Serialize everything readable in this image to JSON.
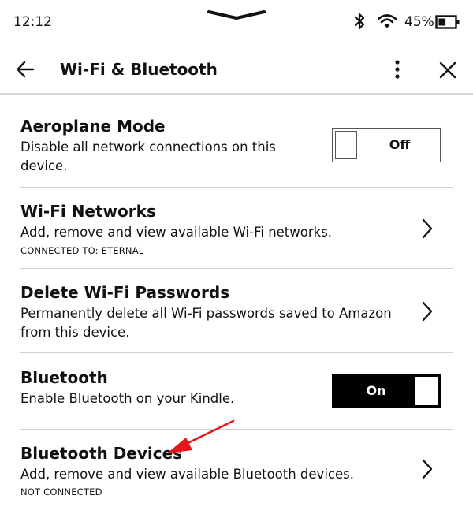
{
  "status_bar": {
    "time": "12:12",
    "battery_percent": "45%",
    "battery_level": 0.45,
    "icons": [
      "pull-down-handle-icon",
      "bluetooth-icon",
      "wifi-icon",
      "battery-icon"
    ]
  },
  "header": {
    "title": "Wi-Fi & Bluetooth",
    "icons": [
      "back-arrow-icon",
      "more-options-icon",
      "close-icon"
    ]
  },
  "settings": {
    "aeroplane": {
      "title": "Aeroplane Mode",
      "desc_line1": "Disable all network connections on this",
      "desc_line2": "device.",
      "toggle_label": "Off"
    },
    "wifi_networks": {
      "title": "Wi-Fi Networks",
      "desc": "Add, remove and view available Wi-Fi networks.",
      "status": "CONNECTED TO: ETERNAL"
    },
    "delete_passwords": {
      "title": "Delete Wi-Fi Passwords",
      "desc_line1": "Permanently delete all Wi-Fi passwords saved to Amazon",
      "desc_line2": "from this device."
    },
    "bluetooth": {
      "title": "Bluetooth",
      "desc": "Enable Bluetooth on your Kindle.",
      "toggle_label": "On"
    },
    "bluetooth_devices": {
      "title": "Bluetooth Devices",
      "desc": "Add, remove and view available Bluetooth devices.",
      "status": "NOT CONNECTED"
    }
  },
  "colors": {
    "annotation_arrow": "#e8141c",
    "divider": "#cfcfcf",
    "toggle_on_bg": "#000000"
  }
}
